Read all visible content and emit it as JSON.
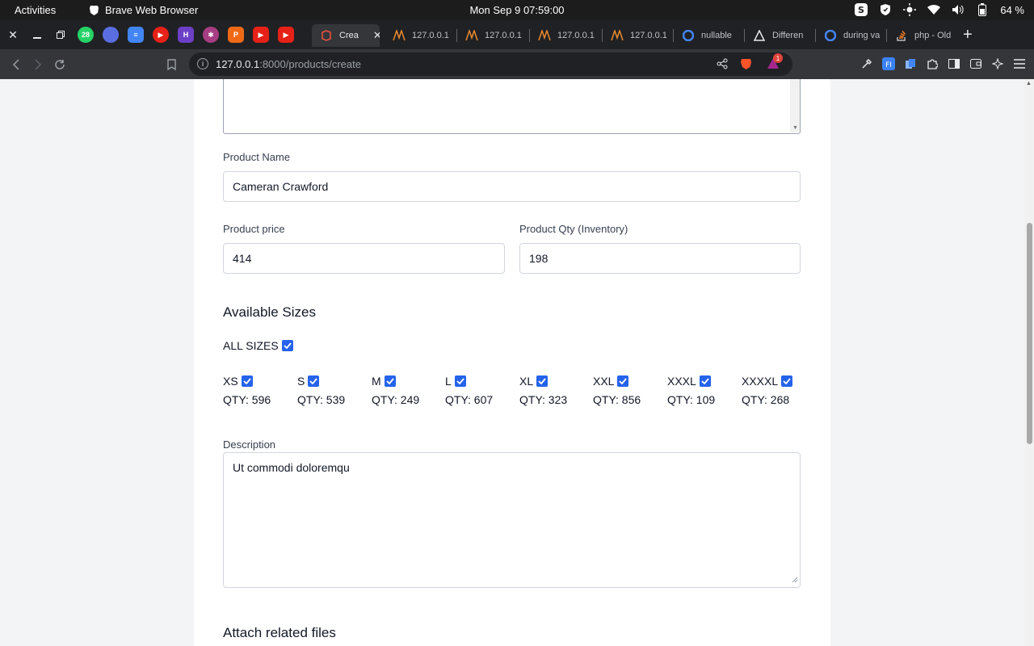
{
  "system_bar": {
    "activities": "Activities",
    "app_name": "Brave Web Browser",
    "clock": "Mon Sep 9  07:59:00",
    "battery": "64 %"
  },
  "tabs": [
    {
      "title": "Crea",
      "active": true
    },
    {
      "title": "127.0.0.1",
      "active": false
    },
    {
      "title": "127.0.0.1",
      "active": false
    },
    {
      "title": "127.0.0.1",
      "active": false
    },
    {
      "title": "127.0.0.1",
      "active": false
    },
    {
      "title": "nullable",
      "active": false
    },
    {
      "title": "Differen",
      "active": false
    },
    {
      "title": "during va",
      "active": false
    },
    {
      "title": "php - Old",
      "active": false
    }
  ],
  "pinned_badge": "28",
  "address_bar": {
    "host": "127.0.0.1",
    "path": ":8000/products/create",
    "rewards_badge": "1"
  },
  "form": {
    "product_name": {
      "label": "Product Name",
      "value": "Cameran Crawford"
    },
    "product_price": {
      "label": "Product price",
      "value": "414"
    },
    "product_qty": {
      "label": "Product Qty (Inventory)",
      "value": "198"
    },
    "available_sizes_title": "Available Sizes",
    "all_sizes": {
      "label": "ALL SIZES",
      "checked": true
    },
    "sizes": [
      {
        "name": "XS",
        "qty": "QTY: 596",
        "checked": true
      },
      {
        "name": "S",
        "qty": "QTY: 539",
        "checked": true
      },
      {
        "name": "M",
        "qty": "QTY: 249",
        "checked": true
      },
      {
        "name": "L",
        "qty": "QTY: 607",
        "checked": true
      },
      {
        "name": "XL",
        "qty": "QTY: 323",
        "checked": true
      },
      {
        "name": "XXL",
        "qty": "QTY: 856",
        "checked": true
      },
      {
        "name": "XXXL",
        "qty": "QTY: 109",
        "checked": true
      },
      {
        "name": "XXXXL",
        "qty": "QTY: 268",
        "checked": true
      }
    ],
    "description": {
      "label": "Description",
      "value": "Ut commodi doloremqu"
    },
    "attach_title": "Attach related files"
  },
  "colors": {
    "checkbox": "#2563eb",
    "brave": "#fb542b"
  }
}
